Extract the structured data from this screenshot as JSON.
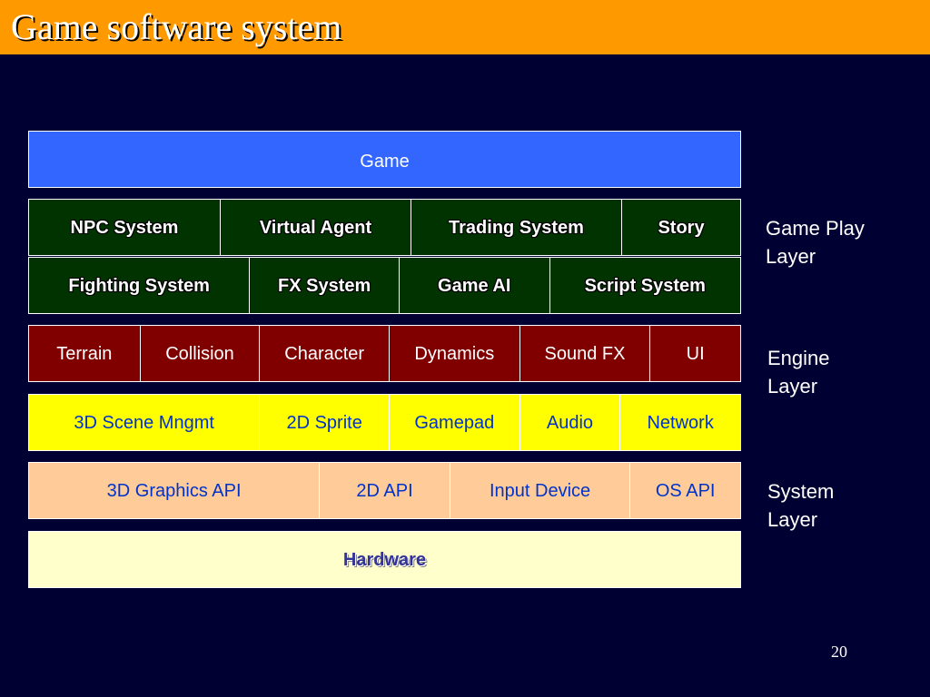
{
  "slide": {
    "title": "Game software system",
    "page_number": "20"
  },
  "colors": {
    "background": "#000033",
    "title_bar": "#FF9900",
    "game_row": "#3366FF",
    "game_play_rows": "#003300",
    "engine_row": "#800000",
    "engine_support_row": "#FFFF00",
    "system_row": "#FFCC99",
    "hardware_row": "#FFFFCC",
    "blue_text": "#0033CC"
  },
  "rows": {
    "game": {
      "cells": [
        "Game"
      ]
    },
    "game_play_1": {
      "cells": [
        "NPC System",
        "Virtual Agent",
        "Trading System",
        "Story"
      ]
    },
    "game_play_2": {
      "cells": [
        "Fighting System",
        "FX System",
        "Game AI",
        "Script System"
      ]
    },
    "engine_1": {
      "cells": [
        "Terrain",
        "Collision",
        "Character",
        "Dynamics",
        "Sound FX",
        "UI"
      ]
    },
    "engine_2": {
      "cells": [
        "3D Scene Mngmt",
        "2D Sprite",
        "Gamepad",
        "Audio",
        "Network"
      ]
    },
    "system": {
      "cells": [
        "3D Graphics API",
        "2D API",
        "Input Device",
        "OS API"
      ]
    },
    "hardware": {
      "cells": [
        "Hardware"
      ]
    }
  },
  "layer_labels": {
    "game_play": {
      "line1": "Game Play",
      "line2": "Layer"
    },
    "engine": {
      "line1": "Engine",
      "line2": "Layer"
    },
    "system": {
      "line1": "System",
      "line2": "Layer"
    }
  }
}
